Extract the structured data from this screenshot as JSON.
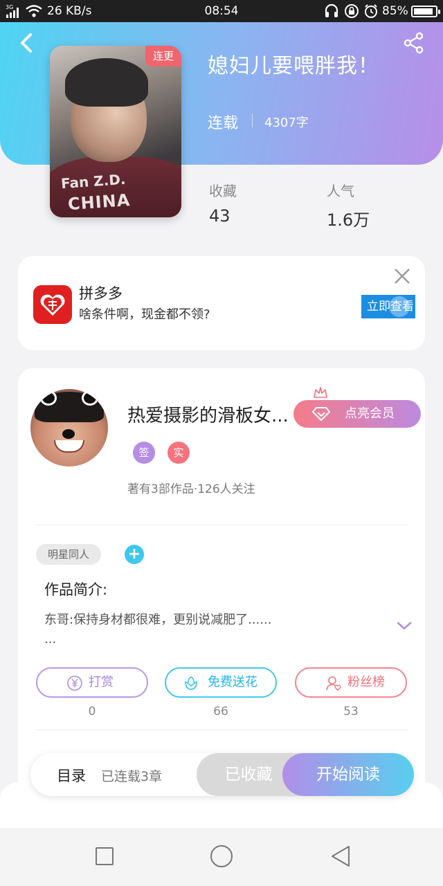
{
  "status_bar": {
    "network": "3G",
    "speed": "26 KB/s",
    "time": "08:54",
    "battery": "85%",
    "icons": [
      "signal-icon",
      "wifi-icon",
      "headphone-icon",
      "lock-icon",
      "alarm-icon",
      "battery-icon"
    ]
  },
  "book": {
    "title": "媳妇儿要喂胖我！",
    "badge": "连更",
    "status": "连载",
    "word_count": "4307字",
    "cover_text_name": "Fan Z.D.",
    "cover_text_country": "CHINA",
    "stats": [
      {
        "label": "收藏",
        "value": "43"
      },
      {
        "label": "人气",
        "value": "1.6万"
      }
    ]
  },
  "ad": {
    "title": "拼多多",
    "description": "啥条件啊，现金都不领?",
    "button": "立即查看",
    "logo_icon": "pinduoduo-logo-icon"
  },
  "author": {
    "name": "热爱摄影的滑板女...",
    "tags": [
      "签",
      "实"
    ],
    "info": "著有3部作品·126人关注",
    "vip_button": "点亮会员"
  },
  "work": {
    "genre_tag": "明星同人",
    "add_tag": "+",
    "intro_label": "作品简介:",
    "intro_line1": "东哥:保持身材都很难，更别说减肥了......",
    "intro_line2": "..."
  },
  "actions": [
    {
      "label": "打赏",
      "count": "0",
      "icon": "yen-icon"
    },
    {
      "label": "免费送花",
      "count": "66",
      "icon": "flower-icon"
    },
    {
      "label": "粉丝榜",
      "count": "53",
      "icon": "fan-ranking-icon"
    }
  ],
  "bottom_bar": {
    "toc": "目录",
    "chapters": "已连载3章",
    "favorited": "已收藏",
    "start_reading": "开始阅读"
  },
  "colors": {
    "header_start": "#4fd4f2",
    "header_end": "#b78ee8",
    "accent_blue": "#41c7ea",
    "accent_purple": "#b799e3",
    "accent_pink": "#f0858e"
  }
}
